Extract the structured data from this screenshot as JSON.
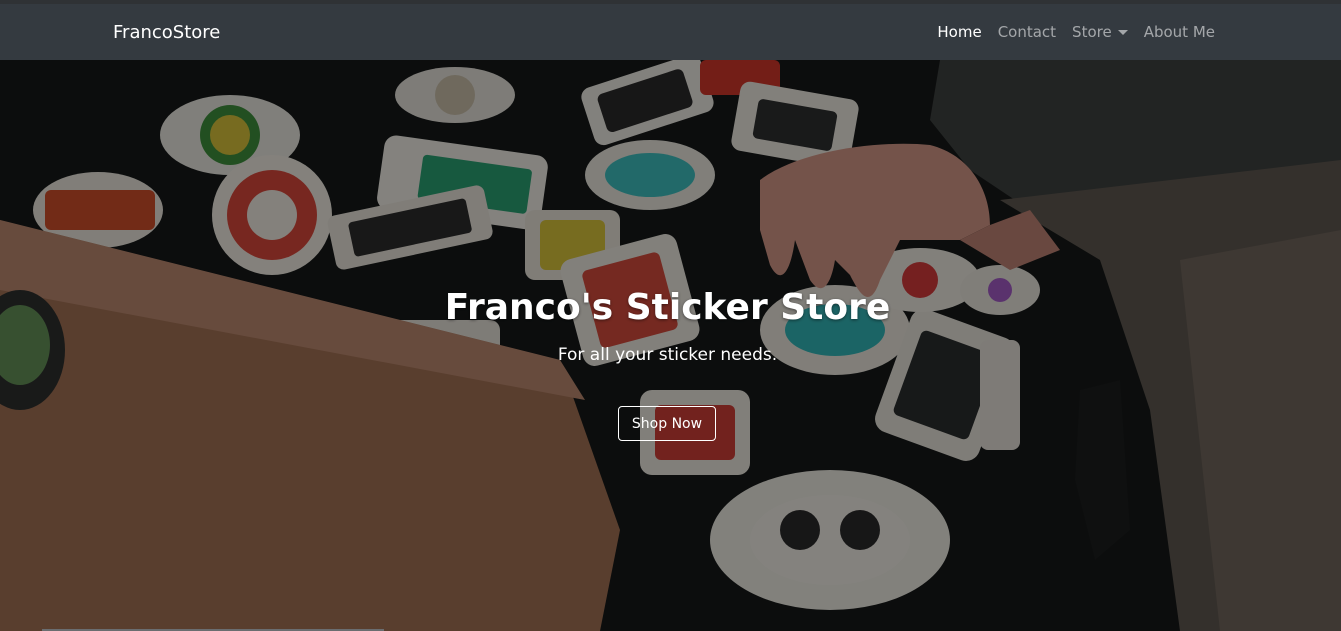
{
  "navbar": {
    "brand": "FrancoStore",
    "links": [
      {
        "label": "Home",
        "active": true
      },
      {
        "label": "Contact",
        "active": false
      },
      {
        "label": "Store",
        "active": false,
        "dropdown": true
      },
      {
        "label": "About Me",
        "active": false
      }
    ]
  },
  "hero": {
    "title": "Franco's Sticker Store",
    "subtitle": "For all your sticker needs.",
    "button_label": "Shop Now"
  },
  "colors": {
    "navbar_bg": "#343a40",
    "text_white": "#ffffff",
    "nav_muted": "rgba(255,255,255,0.55)"
  }
}
